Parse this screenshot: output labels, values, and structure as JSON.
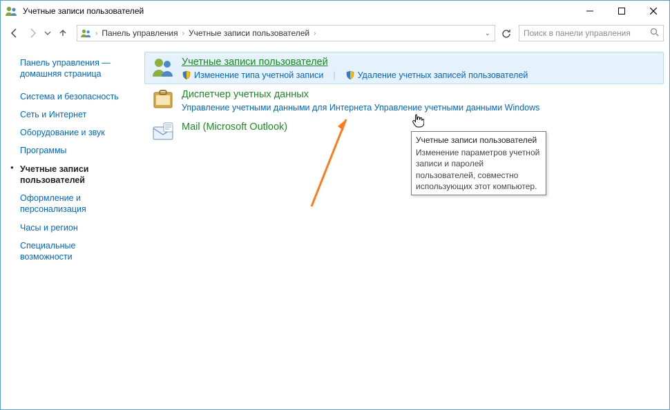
{
  "title": "Учетные записи пользователей",
  "breadcrumbs": {
    "root": "Панель управления",
    "current": "Учетные записи пользователей"
  },
  "search_placeholder": "Поиск в панели управления",
  "sidebar": {
    "home": "Панель управления — домашняя страница",
    "items": [
      "Система и безопасность",
      "Сеть и Интернет",
      "Оборудование и звук",
      "Программы",
      "Учетные записи пользователей",
      "Оформление и персонализация",
      "Часы и регион",
      "Специальные возможности"
    ]
  },
  "groups": {
    "users": {
      "title": "Учетные записи пользователей",
      "link1": "Изменение типа учетной записи",
      "link2": "Удаление учетных записей пользователей"
    },
    "creds": {
      "title": "Диспетчер учетных данных",
      "sub": "Управление учетными данными для Интернета   Управление учетными данными Windows"
    },
    "mail": {
      "title": "Mail (Microsoft Outlook)"
    }
  },
  "tooltip": {
    "heading": "Учетные записи пользователей",
    "body": "Изменение параметров учетной записи и паролей пользователей, совместно использующих этот компьютер."
  }
}
